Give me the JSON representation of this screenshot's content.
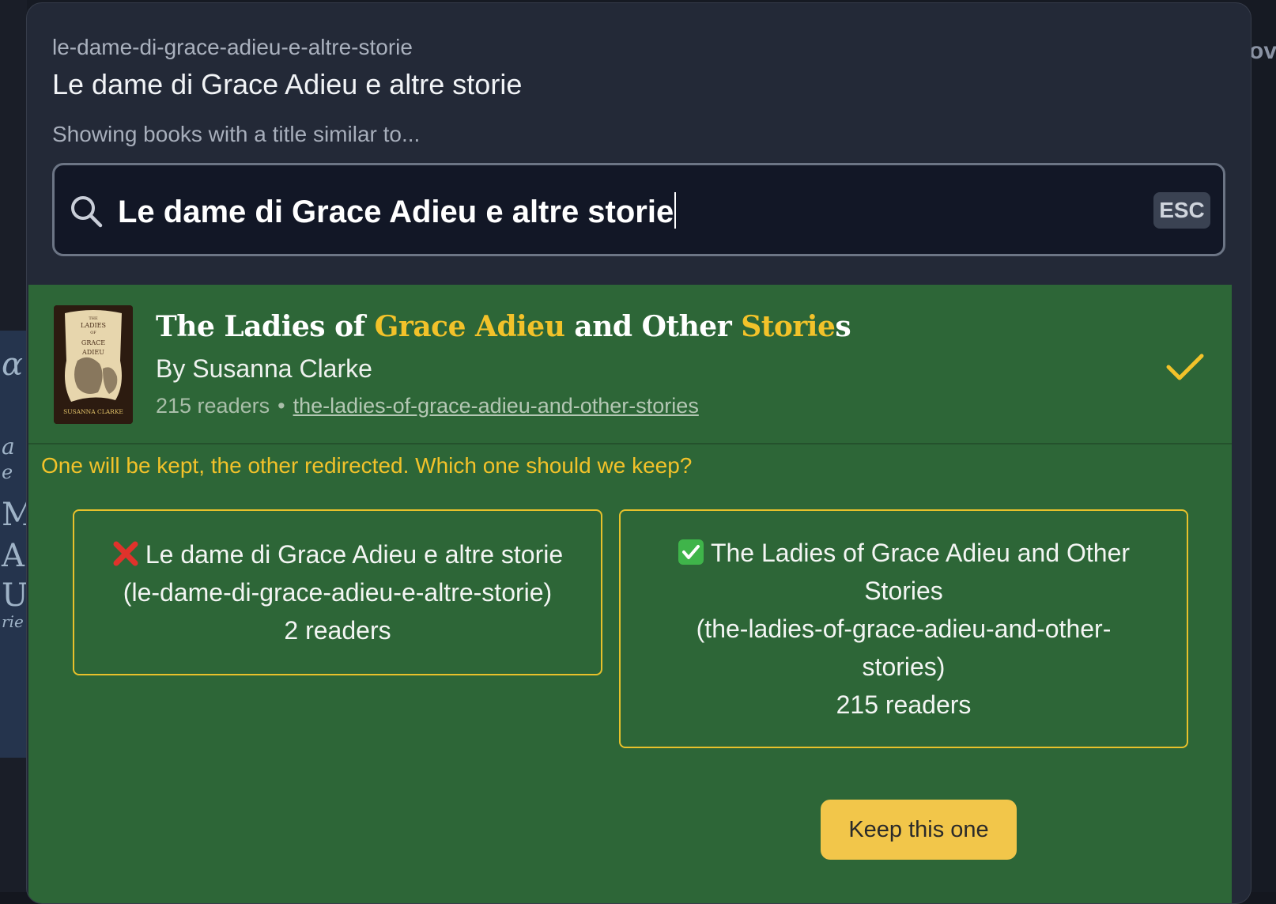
{
  "background": {
    "right_partial_text": "ov",
    "cover_strip_glyphs": [
      "ɑ",
      "a",
      "e",
      "M",
      "A",
      "U",
      "rie"
    ]
  },
  "modal": {
    "slug": "le-dame-di-grace-adieu-e-altre-storie",
    "title": "Le dame di Grace Adieu e altre storie",
    "showing_label": "Showing books with a title similar to...",
    "search": {
      "value": "Le dame di Grace Adieu e altre storie",
      "esc_label": "ESC"
    },
    "result": {
      "cover_text": {
        "top_lines": [
          "THE",
          "LADIES",
          "OF",
          "GRACE",
          "ADIEU"
        ],
        "author": "SUSANNA CLARKE"
      },
      "title_parts": [
        {
          "text": "The Ladies of ",
          "highlight": false
        },
        {
          "text": "Grace Adieu",
          "highlight": true
        },
        {
          "text": " and Other ",
          "highlight": false
        },
        {
          "text": "Storie",
          "highlight": true
        },
        {
          "text": "s",
          "highlight": false
        }
      ],
      "author": "By Susanna Clarke",
      "readers": "215 readers",
      "separator": "•",
      "slug_link": "the-ladies-of-grace-adieu-and-other-stories",
      "selected": true
    },
    "question": "One will be kept, the other redirected. Which one should we keep?",
    "choices": {
      "left": {
        "icon": "red-x-icon",
        "title": "Le dame di Grace Adieu e altre storie",
        "slug": "(le-dame-di-grace-adieu-e-altre-storie)",
        "readers": "2 readers"
      },
      "right": {
        "icon": "green-check-icon",
        "title_line1": "The Ladies of Grace Adieu and Other",
        "title_line2": "Stories",
        "slug_line1": "(the-ladies-of-grace-adieu-and-other-",
        "slug_line2": "stories)",
        "readers": "215 readers"
      }
    },
    "keep_button": "Keep this one"
  },
  "colors": {
    "modal_bg": "#232937",
    "green_panel": "#2d6637",
    "accent_yellow": "#f2c22a",
    "button_yellow": "#f2c64a"
  }
}
